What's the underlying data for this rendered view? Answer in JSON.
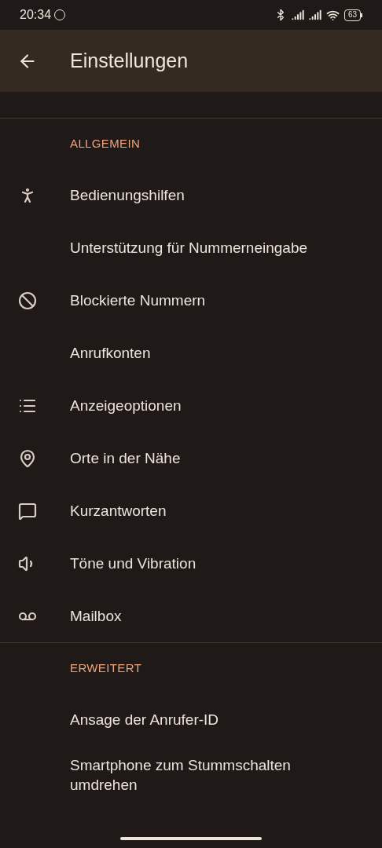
{
  "status_bar": {
    "time": "20:34",
    "battery": "63"
  },
  "app_bar": {
    "title": "Einstellungen"
  },
  "sections": [
    {
      "header": "ALLGEMEIN",
      "items": [
        {
          "label": "Bedienungshilfen"
        },
        {
          "label": "Unterstützung für Nummerneingabe"
        },
        {
          "label": "Blockierte Nummern"
        },
        {
          "label": "Anrufkonten"
        },
        {
          "label": "Anzeigeoptionen"
        },
        {
          "label": "Orte in der Nähe"
        },
        {
          "label": "Kurzantworten"
        },
        {
          "label": "Töne und Vibration"
        },
        {
          "label": "Mailbox"
        }
      ]
    },
    {
      "header": "ERWEITERT",
      "items": [
        {
          "label": "Ansage der Anrufer-ID"
        },
        {
          "label": "Smartphone zum Stummschalten umdrehen"
        }
      ]
    }
  ]
}
